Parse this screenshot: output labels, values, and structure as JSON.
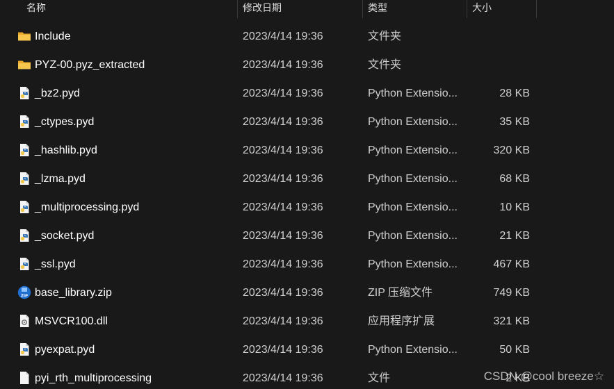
{
  "columns": {
    "name": "名称",
    "modified": "修改日期",
    "type": "类型",
    "size": "大小"
  },
  "files": [
    {
      "name": "Include",
      "date": "2023/4/14 19:36",
      "type": "文件夹",
      "size": "",
      "icon": "folder-icon"
    },
    {
      "name": "PYZ-00.pyz_extracted",
      "date": "2023/4/14 19:36",
      "type": "文件夹",
      "size": "",
      "icon": "folder-icon"
    },
    {
      "name": "_bz2.pyd",
      "date": "2023/4/14 19:36",
      "type": "Python Extensio...",
      "size": "28 KB",
      "icon": "python-file-icon"
    },
    {
      "name": "_ctypes.pyd",
      "date": "2023/4/14 19:36",
      "type": "Python Extensio...",
      "size": "35 KB",
      "icon": "python-file-icon"
    },
    {
      "name": "_hashlib.pyd",
      "date": "2023/4/14 19:36",
      "type": "Python Extensio...",
      "size": "320 KB",
      "icon": "python-file-icon"
    },
    {
      "name": "_lzma.pyd",
      "date": "2023/4/14 19:36",
      "type": "Python Extensio...",
      "size": "68 KB",
      "icon": "python-file-icon"
    },
    {
      "name": "_multiprocessing.pyd",
      "date": "2023/4/14 19:36",
      "type": "Python Extensio...",
      "size": "10 KB",
      "icon": "python-file-icon"
    },
    {
      "name": "_socket.pyd",
      "date": "2023/4/14 19:36",
      "type": "Python Extensio...",
      "size": "21 KB",
      "icon": "python-file-icon"
    },
    {
      "name": "_ssl.pyd",
      "date": "2023/4/14 19:36",
      "type": "Python Extensio...",
      "size": "467 KB",
      "icon": "python-file-icon"
    },
    {
      "name": "base_library.zip",
      "date": "2023/4/14 19:36",
      "type": "ZIP 压缩文件",
      "size": "749 KB",
      "icon": "zip-file-icon"
    },
    {
      "name": "MSVCR100.dll",
      "date": "2023/4/14 19:36",
      "type": "应用程序扩展",
      "size": "321 KB",
      "icon": "dll-file-icon"
    },
    {
      "name": "pyexpat.pyd",
      "date": "2023/4/14 19:36",
      "type": "Python Extensio...",
      "size": "50 KB",
      "icon": "python-file-icon"
    },
    {
      "name": "pyi_rth_multiprocessing",
      "date": "2023/4/14 19:36",
      "type": "文件",
      "size": "2 KB",
      "icon": "generic-file-icon"
    }
  ],
  "watermark": "CSDN @cool breeze☆"
}
